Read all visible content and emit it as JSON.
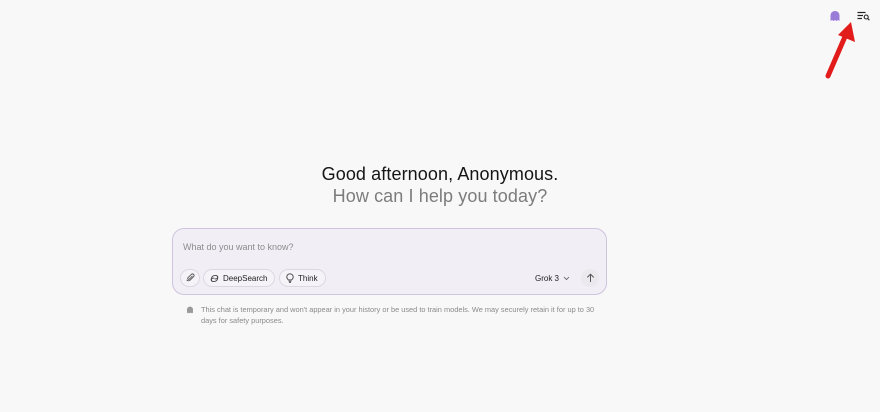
{
  "header": {
    "private_chat_icon": "ghost-icon",
    "history_icon": "history-search-icon",
    "accent_color": "#9b7bd9"
  },
  "greeting": {
    "line1": "Good afternoon, Anonymous.",
    "line2": "How can I help you today?"
  },
  "composer": {
    "placeholder": "What do you want to know?",
    "value": "",
    "attach_icon": "paperclip-icon",
    "deepsearch_label": "DeepSearch",
    "deepsearch_icon": "deepsearch-icon",
    "think_label": "Think",
    "think_icon": "lightbulb-icon",
    "model_label": "Grok 3",
    "model_icon": "chevron-down-icon",
    "send_icon": "arrow-up-icon",
    "border_color": "#cfc3dd",
    "background_color": "#f2eef6"
  },
  "disclaimer": {
    "icon": "ghost-icon",
    "text": "This chat is temporary and won't appear in your history or be used to train models. We may securely retain it for up to 30 days for safety purposes."
  },
  "annotation": {
    "arrow_color": "#e21b1b",
    "arrow_icon": "red-arrow-icon"
  }
}
